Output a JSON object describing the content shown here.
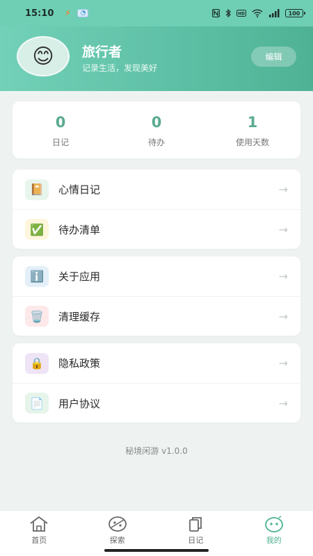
{
  "status_bar": {
    "time": "15:10",
    "network": "4G",
    "battery": "100"
  },
  "profile": {
    "avatar_emoji": "😊",
    "name": "旅行者",
    "motto": "记录生活，发现美好",
    "edit_label": "编辑"
  },
  "stats": [
    {
      "value": "0",
      "label": "日记"
    },
    {
      "value": "0",
      "label": "待办"
    },
    {
      "value": "1",
      "label": "使用天数"
    }
  ],
  "menu_groups": [
    [
      {
        "icon": "📔",
        "icon_name": "diary-icon",
        "label": "心情日记",
        "bg": "#e8f5ec"
      },
      {
        "icon": "✅",
        "icon_name": "checkmark-icon",
        "label": "待办清单",
        "bg": "#fdf6dc"
      }
    ],
    [
      {
        "icon": "ℹ️",
        "icon_name": "info-icon",
        "label": "关于应用",
        "bg": "#e4eff9"
      },
      {
        "icon": "🗑️",
        "icon_name": "trash-icon",
        "label": "清理缓存",
        "bg": "#fde8ea"
      }
    ],
    [
      {
        "icon": "🔒",
        "icon_name": "lock-icon",
        "label": "隐私政策",
        "bg": "#efe4f6"
      },
      {
        "icon": "📄",
        "icon_name": "document-icon",
        "label": "用户协议",
        "bg": "#e6f4ea"
      }
    ]
  ],
  "arrow": "→",
  "version": "秘境闲游 v1.0.0",
  "nav": [
    {
      "label": "首页",
      "icon_name": "home-icon"
    },
    {
      "label": "探索",
      "icon_name": "explore-icon"
    },
    {
      "label": "日记",
      "icon_name": "diary-stack-icon"
    },
    {
      "label": "我的",
      "icon_name": "profile-face-icon",
      "active": true
    }
  ],
  "colors": {
    "accent": "#5aab8f",
    "header_start": "#72d1b8",
    "header_end": "#4fb294",
    "nav_active": "#4bb28f"
  }
}
